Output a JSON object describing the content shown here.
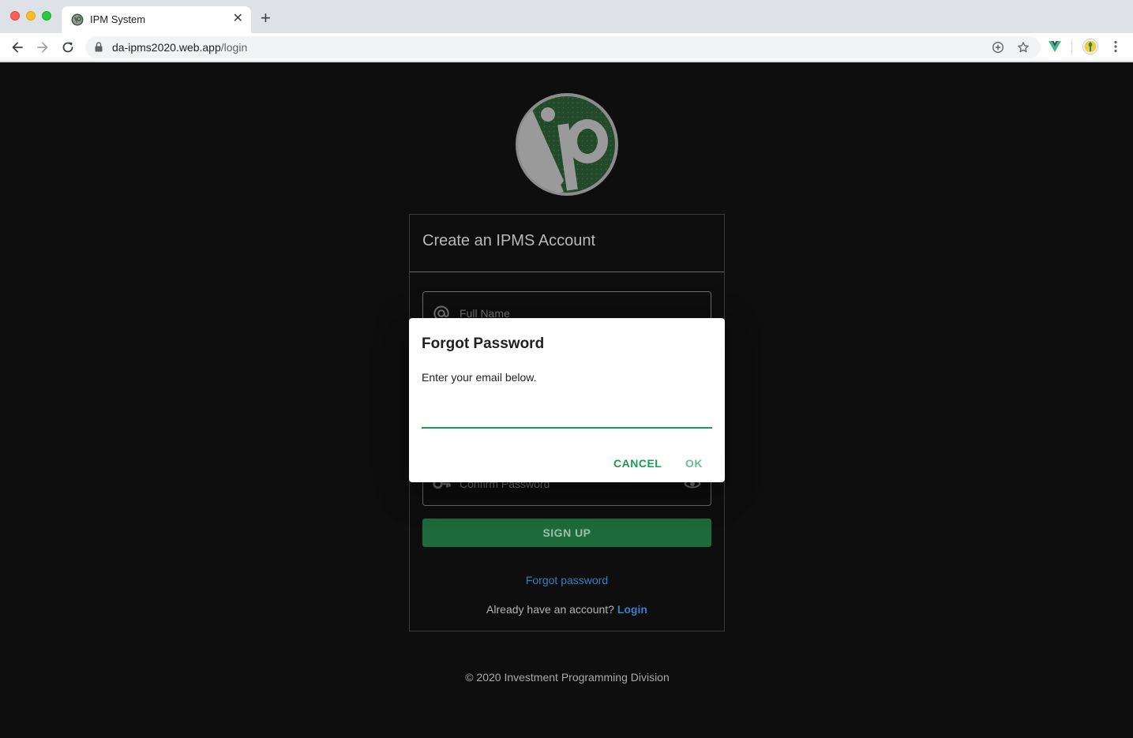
{
  "browser": {
    "tab_title": "IPM System",
    "tab_close": "✕",
    "new_tab": "+",
    "url_host": "da-ipms2020.web.app",
    "url_path": "/login"
  },
  "card": {
    "title": "Create an IPMS Account",
    "fullname_placeholder": "Full Name",
    "confirm_placeholder": "Confirm Password",
    "signup_label": "SIGN UP",
    "forgot_link": "Forgot password",
    "already_text": "Already have an account? ",
    "login_link": "Login"
  },
  "footer": {
    "text": "© 2020 Investment Programming Division"
  },
  "dialog": {
    "title": "Forgot Password",
    "text": "Enter your email below.",
    "email_value": "",
    "cancel_label": "CANCEL",
    "ok_label": "OK"
  },
  "colors": {
    "page_bg": "#0e0e0e",
    "primary_green": "#1e9a4f",
    "signup_green": "#1d6b3a",
    "link_blue": "#3a7ec4"
  },
  "icons": {
    "favicon": "ipm-logo-icon",
    "fullname_field": "at-sign-icon",
    "confirm_field": "key-icon",
    "confirm_toggle": "eye-icon"
  }
}
